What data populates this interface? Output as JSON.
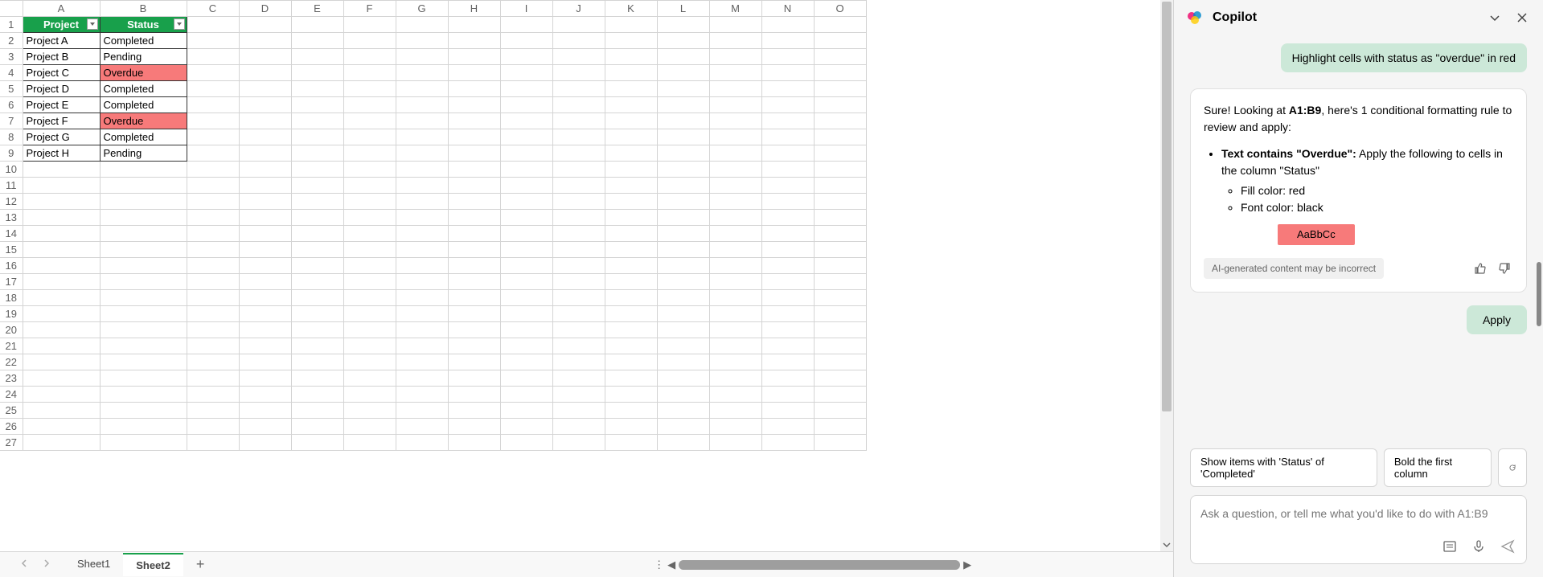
{
  "columns": [
    "A",
    "B",
    "C",
    "D",
    "E",
    "F",
    "G",
    "H",
    "I",
    "J",
    "K",
    "L",
    "M",
    "N",
    "O"
  ],
  "rowCount": 27,
  "table": {
    "headers": [
      "Project",
      "Status"
    ],
    "rows": [
      {
        "project": "Project A",
        "status": "Completed",
        "overdue": false
      },
      {
        "project": "Project B",
        "status": "Pending",
        "overdue": false
      },
      {
        "project": "Project C",
        "status": "Overdue",
        "overdue": true
      },
      {
        "project": "Project D",
        "status": "Completed",
        "overdue": false
      },
      {
        "project": "Project E",
        "status": "Completed",
        "overdue": false
      },
      {
        "project": "Project F",
        "status": "Overdue",
        "overdue": true
      },
      {
        "project": "Project G",
        "status": "Completed",
        "overdue": false
      },
      {
        "project": "Project H",
        "status": "Pending",
        "overdue": false
      }
    ]
  },
  "sheets": {
    "tabs": [
      "Sheet1",
      "Sheet2"
    ],
    "active": "Sheet2"
  },
  "copilot": {
    "title": "Copilot",
    "userMsg": "Highlight cells with status as \"overdue\" in red",
    "response": {
      "intro_prefix": "Sure! Looking at ",
      "range": "A1:B9",
      "intro_suffix": ", here's 1 conditional formatting rule to review and apply:",
      "rule_bold": "Text contains \"Overdue\":",
      "rule_rest": " Apply the following to cells in the column \"Status\"",
      "sub1": "Fill color: red",
      "sub2": "Font color: black",
      "sample": "AaBbCc"
    },
    "disclaimer": "AI-generated content may be incorrect",
    "apply": "Apply",
    "suggestions": [
      "Show items with 'Status' of 'Completed'",
      "Bold the first column"
    ],
    "inputPlaceholder": "Ask a question, or tell me what you'd like to do with A1:B9"
  }
}
